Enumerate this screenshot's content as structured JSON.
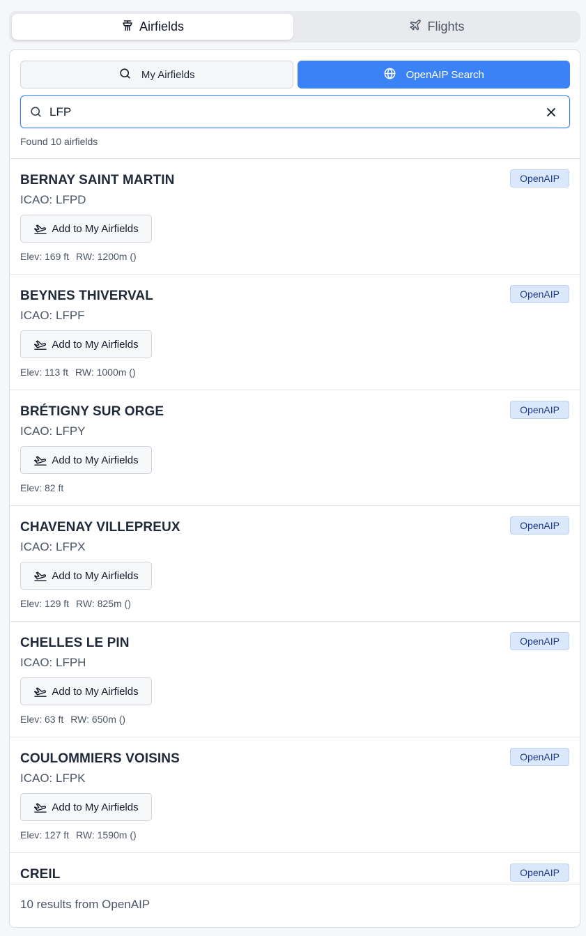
{
  "top_tabs": [
    {
      "label": "Airfields",
      "icon": "tower-icon",
      "active": true
    },
    {
      "label": "Flights",
      "icon": "plane-icon",
      "active": false
    }
  ],
  "mode_buttons": [
    {
      "label": "My Airfields",
      "icon": "search-icon",
      "active": false
    },
    {
      "label": "OpenAIP Search",
      "icon": "globe-icon",
      "active": true
    }
  ],
  "search": {
    "value": "LFP",
    "placeholder": ""
  },
  "found_text": "Found 10 airfields",
  "add_button_label": "Add to My Airfields",
  "results": [
    {
      "name": "BERNAY SAINT MARTIN",
      "icao": "ICAO: LFPD",
      "badge": "OpenAIP",
      "elev": "Elev: 169 ft",
      "runway": "RW: 1200m ()"
    },
    {
      "name": "BEYNES THIVERVAL",
      "icao": "ICAO: LFPF",
      "badge": "OpenAIP",
      "elev": "Elev: 113 ft",
      "runway": "RW: 1000m ()"
    },
    {
      "name": "BRÉTIGNY SUR ORGE",
      "icao": "ICAO: LFPY",
      "badge": "OpenAIP",
      "elev": "Elev: 82 ft",
      "runway": ""
    },
    {
      "name": "CHAVENAY VILLEPREUX",
      "icao": "ICAO: LFPX",
      "badge": "OpenAIP",
      "elev": "Elev: 129 ft",
      "runway": "RW: 825m ()"
    },
    {
      "name": "CHELLES LE PIN",
      "icao": "ICAO: LFPH",
      "badge": "OpenAIP",
      "elev": "Elev: 63 ft",
      "runway": "RW: 650m ()"
    },
    {
      "name": "COULOMMIERS VOISINS",
      "icao": "ICAO: LFPK",
      "badge": "OpenAIP",
      "elev": "Elev: 127 ft",
      "runway": "RW: 1590m ()"
    },
    {
      "name": "CREIL",
      "icao": "",
      "badge": "OpenAIP",
      "elev": "",
      "runway": ""
    }
  ],
  "footer_text": "10 results from OpenAIP",
  "colors": {
    "accent": "#3b82f6",
    "badge_bg": "#dbe8fb",
    "badge_text": "#1e3a8a"
  }
}
